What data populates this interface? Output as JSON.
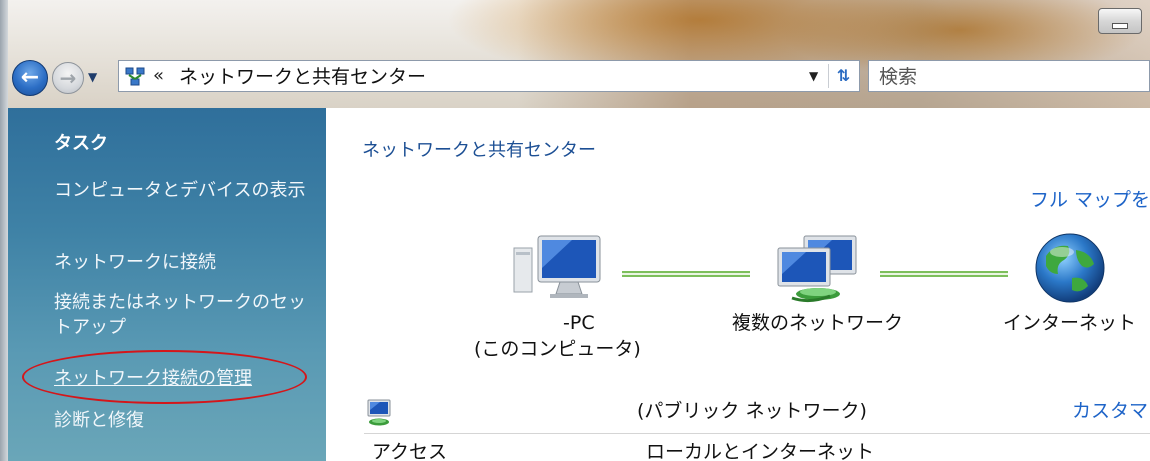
{
  "window": {
    "address_path": "ネットワークと共有センター",
    "address_separator": "«",
    "search_placeholder": "検索"
  },
  "sidebar": {
    "title": "タスク",
    "items": [
      {
        "label": "コンピュータとデバイスの表示"
      },
      {
        "label": "ネットワークに接続"
      },
      {
        "label": "接続またはネットワークのセットアップ"
      },
      {
        "label": "ネットワーク接続の管理"
      },
      {
        "label": "診断と修復"
      }
    ]
  },
  "main": {
    "header": "ネットワークと共有センター",
    "full_map_link": "フル マップを",
    "nodes": [
      {
        "name": "-PC",
        "sub": "(このコンピュータ)",
        "icon": "computer-icon"
      },
      {
        "name": "複数のネットワーク",
        "icon": "network-icon"
      },
      {
        "name": "インターネット",
        "icon": "globe-icon"
      }
    ],
    "network_type": "(パブリック ネットワーク)",
    "customize_link": "カスタマ",
    "access_label": "アクセス",
    "access_value": "ローカルとインターネット"
  },
  "colors": {
    "sidebar_top": "#2f6f9b",
    "sidebar_bottom": "#6aa6b8",
    "link_blue": "#1e64c8",
    "highlight_ellipse": "#d4161a",
    "connection_line": "#7dbf5c"
  }
}
